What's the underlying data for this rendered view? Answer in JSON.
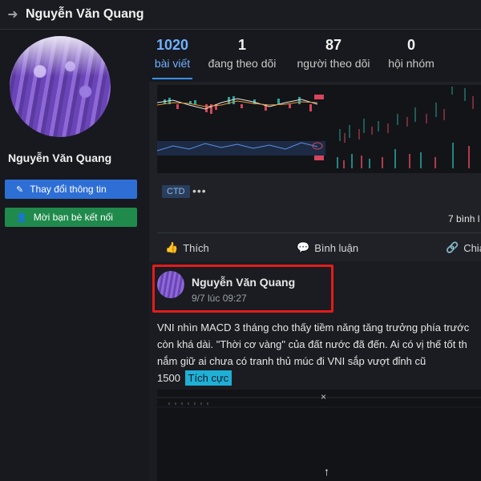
{
  "header": {
    "title": "Nguyễn Văn Quang",
    "back_icon": "arrow-left-icon"
  },
  "profile": {
    "name": "Nguyễn Văn Quang",
    "edit_button": "Thay đổi thông tin",
    "invite_button": "Mời bạn bè kết nối"
  },
  "stats": [
    {
      "value": "1020",
      "label": "bài viết"
    },
    {
      "value": "1",
      "label": "đang theo dõi"
    },
    {
      "value": "87",
      "label": "người theo dõi"
    },
    {
      "value": "0",
      "label": "hội nhóm"
    }
  ],
  "previous_post": {
    "tag": "CTD",
    "more": "•••",
    "views": "7 bình l",
    "actions": {
      "like": "Thích",
      "comment": "Bình luận",
      "share": "Chia"
    }
  },
  "post": {
    "author": "Nguyễn Văn Quang",
    "time": "9/7 lúc 09:27",
    "lines": [
      "VNI nhìn MACD 3 tháng cho thấy tiềm năng tăng trưởng phía trước",
      "còn khá dài. \"Thời cơ vàng\" của đất nước đã đến. Ai có vị thế tốt th",
      "nắm giữ ai chưa có tranh thủ múc đi VNI sắp vượt đỉnh cũ"
    ],
    "last_line_prefix": "1500",
    "sentiment": "Tích cực",
    "close": "×",
    "up": "↑"
  },
  "colors": {
    "accent": "#3b8eea",
    "edit_button": "#2e6fd6",
    "invite_button": "#1f8a4c",
    "highlight_border": "#e21c1c",
    "sentiment_badge": "#1fb0d6"
  }
}
